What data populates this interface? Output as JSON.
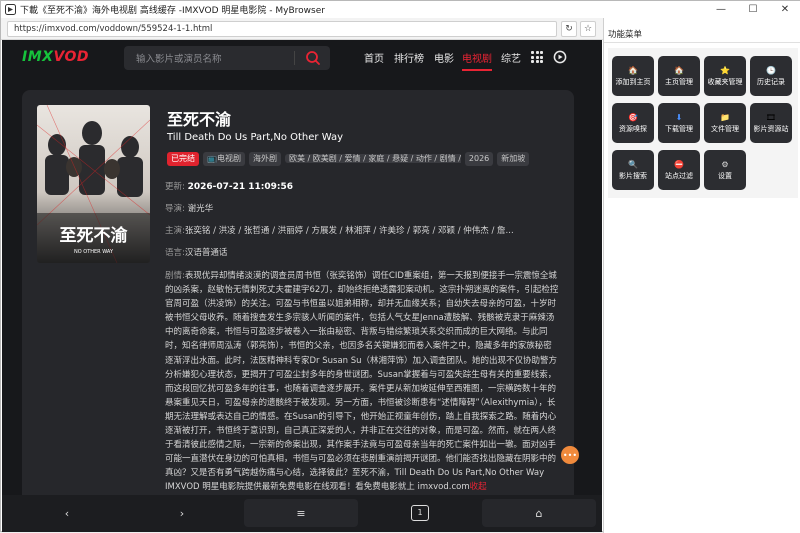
{
  "window": {
    "title": "下載《至死不渝》海外电视剧 高线缓存 -IMXVOD 明星电影院 - MyBrowser",
    "minimize": "—",
    "maximize": "☐",
    "close": "✕"
  },
  "addressbar": {
    "url": "https://imxvod.com/voddown/559524-1-1.html",
    "reload": "↻",
    "bookmark": "☆"
  },
  "side": {
    "title": "功能菜单",
    "items": [
      {
        "label": "添加到主页",
        "icon": "home-icon",
        "glyph": "🏠"
      },
      {
        "label": "主页管理",
        "icon": "home-settings-icon",
        "glyph": "🏠"
      },
      {
        "label": "收藏夹管理",
        "icon": "star-icon",
        "glyph": "⭐"
      },
      {
        "label": "历史记录",
        "icon": "clock-icon",
        "glyph": "🕒"
      },
      {
        "label": "资源嗅探",
        "icon": "sniff-icon",
        "glyph": "🎯"
      },
      {
        "label": "下载管理",
        "icon": "download-icon",
        "glyph": "⬇"
      },
      {
        "label": "文件管理",
        "icon": "folder-icon",
        "glyph": "📁"
      },
      {
        "label": "影片资源站",
        "icon": "film-icon",
        "glyph": "🎞"
      },
      {
        "label": "影片搜索",
        "icon": "search-icon",
        "glyph": "🔍"
      },
      {
        "label": "站点过滤",
        "icon": "filter-icon",
        "glyph": "⛔"
      },
      {
        "label": "设置",
        "icon": "gear-icon",
        "glyph": "⚙"
      }
    ]
  },
  "site": {
    "logo_a": "IMX",
    "logo_b": "VOD",
    "search_placeholder": "输入影片或演员名称",
    "nav": [
      "首页",
      "排行榜",
      "电影",
      "电视剧",
      "综艺"
    ],
    "active_nav": "电视剧"
  },
  "movie": {
    "poster_title": "至死不渝",
    "poster_sub": "NO OTHER WAY",
    "title": "至死不渝",
    "subtitle": "Till Death Do Us Part,No Other Way",
    "tags": {
      "status": "已完结",
      "type": "电视剧",
      "genres": [
        "海外剧",
        "欧美",
        "欧美剧",
        "爱情",
        "家庭",
        "悬疑",
        "动作",
        "剧情"
      ],
      "year": "2026",
      "update": "新加坡"
    },
    "updated_label": "更新:",
    "updated": "2026-07-21 11:09:56",
    "director_label": "导演:",
    "director": "谢光华",
    "cast_label": "主演:",
    "cast": "张奕铭 / 洪凌 / 张哲通 / 洪丽婷 / 方展发 / 林湘萍 / 许美珍 / 郭亮 / 邓颖 / 仲伟杰 / 詹...",
    "language_label": "语言:",
    "language": "汉语普通话",
    "plot_label": "剧情:",
    "plot": "表现优异却情绪淡漠的调查员周书恒（张奕铭饰）调任CID重案组，第一天报到便接手一宗震惊全城的凶杀案，赵敏怡无情刺死丈夫霍建宇62刀，却始终拒绝透露犯案动机。这宗扑朔迷离的案件，引起检控官周可盈（洪凌饰）的关注。可盈与书恒虽以姐弟相称，却并无血缘关系；自幼失去母亲的可盈，十岁时被书恒父母收养。随着搜查发生多宗骇人听闻的案件，包括人气女星Jenna遭肢解、残骸被克隶于麻辣汤中的离奇命案，书恒与可盈逐步被卷入一张由秘密、背叛与错综繁琐关系交织而成的巨大网络。与此同时，知名律师周泓涛（郭亮饰），书恒的父亲，也因多名关键嫌犯而卷入案件之中，隐藏多年的家族秘密逐渐浮出水面。此时，法医精神科专家Dr Susan Su（林湘萍饰）加入调查团队。她的出现不仅协助警方分析嫌犯心理状态，更揭开了可盈尘封多年的身世谜团。Susan掌握着与可盈失踪生母有关的重要线索，而这段回忆扰可盈多年的往事，也随着调查逐步展开。案件更从新加坡延伸至西雅图，一宗横跨数十年的悬案重见天日，可盈母亲的遗骸终于被发现。另一方面，书恒被诊断患有“述情障碍”（Alexithymia），长期无法理解或表达自己的情感。在Susan的引导下，他开始正视童年创伤，踏上自我探索之路。随着内心逐渐被打开，书恒终于意识到，自己真正深爱的人，并非正在交往的对象，而是可盈。然而，就在两人终于看清彼此感情之际，一宗新的命案出现，其作案手法竟与可盈母亲当年的死亡案件如出一辙。面对凶手可能一直潜伏在身边的可怕真相，书恒与可盈必须在悲剧重演前揭开谜团。他们能否找出隐藏在阴影中的真凶？又是否有勇气跨越伤痛与心结，选择彼此？至死不渝，Till Death Do Us Part,No Other Way IMXVOD 明星电影院提供最新免费电影在线观看！看免费电影就上 imxvod.com",
    "plot_more": "收起"
  },
  "bottom": {
    "back": "‹",
    "forward": "›",
    "menu": "≡",
    "tabs": "1",
    "home": "⌂"
  },
  "colors": {
    "accent": "#e92434",
    "logo_green": "#16c23c",
    "page_bg": "#17181b",
    "card_bg": "#26272b"
  }
}
